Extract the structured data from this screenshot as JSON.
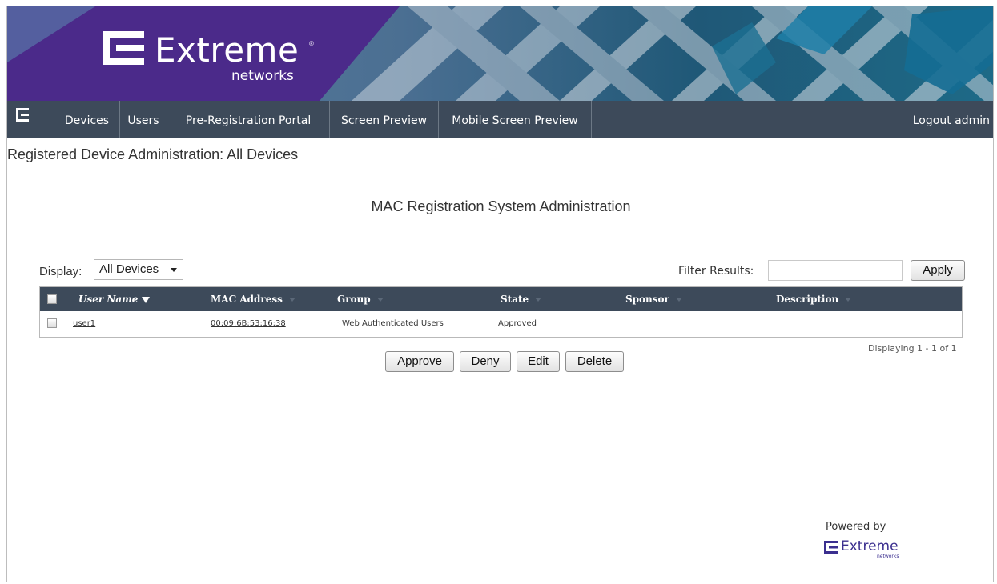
{
  "brand": {
    "name": "Extreme",
    "sub": "networks",
    "reg": "®",
    "purple": "#4b2a8a",
    "nav_bg": "#3d4a5a"
  },
  "nav": {
    "items": [
      "Devices",
      "Users",
      "Pre-Registration Portal",
      "Screen Preview",
      "Mobile Screen Preview"
    ],
    "logout": "Logout admin"
  },
  "page": {
    "heading": "Registered Device Administration: All Devices",
    "title": "MAC Registration System Administration"
  },
  "controls": {
    "display_label": "Display:",
    "display_value": "All Devices",
    "filter_label": "Filter Results:",
    "filter_value": "",
    "apply": "Apply"
  },
  "table": {
    "columns": [
      "User Name",
      "MAC Address",
      "Group",
      "State",
      "Sponsor",
      "Description"
    ],
    "sorted_column": "User Name",
    "rows": [
      {
        "user": "user1",
        "mac": "00:09:6B:53:16:38",
        "group": "Web Authenticated Users",
        "state": "Approved",
        "sponsor": "",
        "description": ""
      }
    ],
    "pager": "Displaying 1 - 1 of 1"
  },
  "actions": {
    "approve": "Approve",
    "deny": "Deny",
    "edit": "Edit",
    "delete": "Delete"
  },
  "footer": {
    "powered": "Powered by",
    "logo_name": "Extreme",
    "logo_sub": "networks"
  }
}
